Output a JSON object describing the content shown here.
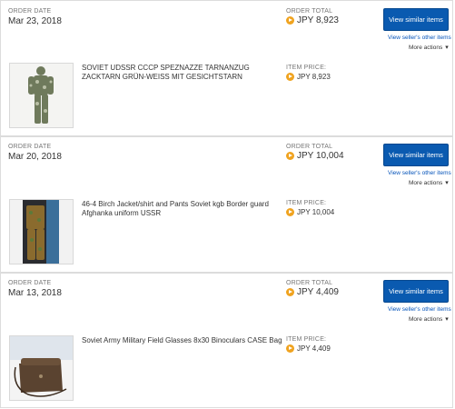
{
  "labels": {
    "order_date": "ORDER DATE",
    "order_total": "ORDER TOTAL",
    "item_price": "ITEM PRICE:",
    "view_similar": "View similar items",
    "view_seller": "View seller's other items",
    "more_actions": "More actions"
  },
  "orders": [
    {
      "date": "Mar 23, 2018",
      "total": "JPY 8,923",
      "item_title": "SOVIET UDSSR CCCP SPEZNAZZE TARNANZUG ZACKTARN GRÜN-WEISS MIT GESICHTSTARN",
      "item_price": "JPY 8,923",
      "thumb_icon": "camouflage-suit-photo"
    },
    {
      "date": "Mar 20, 2018",
      "total": "JPY 10,004",
      "item_title": "46-4 Birch Jacket/shirt and Pants Soviet kgb Border guard Afghanka uniform USSR",
      "item_price": "JPY 10,004",
      "thumb_icon": "uniform-photo"
    },
    {
      "date": "Mar 13, 2018",
      "total": "JPY 4,409",
      "item_title": "Soviet Army Military Field Glasses 8x30 Binoculars CASE Bag",
      "item_price": "JPY 4,409",
      "thumb_icon": "binocular-case-photo"
    }
  ],
  "colors": {
    "button_bg": "#0a5ab0",
    "link": "#0654ba",
    "currency_icon": "#f0a31f",
    "border": "#dcdcdc"
  }
}
